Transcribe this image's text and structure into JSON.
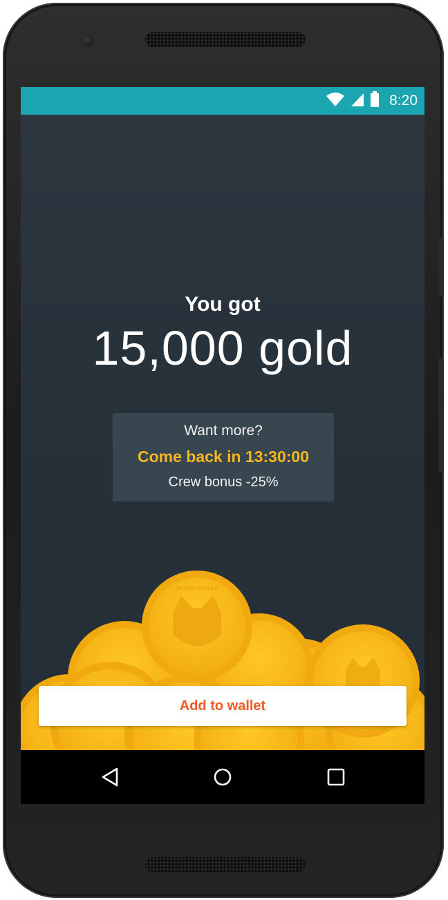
{
  "status_bar": {
    "time": "8:20",
    "icons": [
      "wifi-icon",
      "cell-signal-icon",
      "battery-icon"
    ],
    "background": "#1aa5b1"
  },
  "reward": {
    "heading": "You got",
    "amount": "15,000 gold"
  },
  "info_card": {
    "prompt": "Want more?",
    "countdown": "Come back in 13:30:00",
    "bonus": "Crew bonus -25%"
  },
  "coins": {
    "engraving": "In cats we trust",
    "color": "#f5b71c"
  },
  "actions": {
    "add_to_wallet": "Add to wallet"
  },
  "nav_bar": {
    "buttons": [
      "back-icon",
      "home-icon",
      "recents-icon"
    ]
  },
  "colors": {
    "accent": "#f5b71c",
    "button_text": "#ee5a24",
    "background": "#27313a",
    "card": "#384650"
  }
}
